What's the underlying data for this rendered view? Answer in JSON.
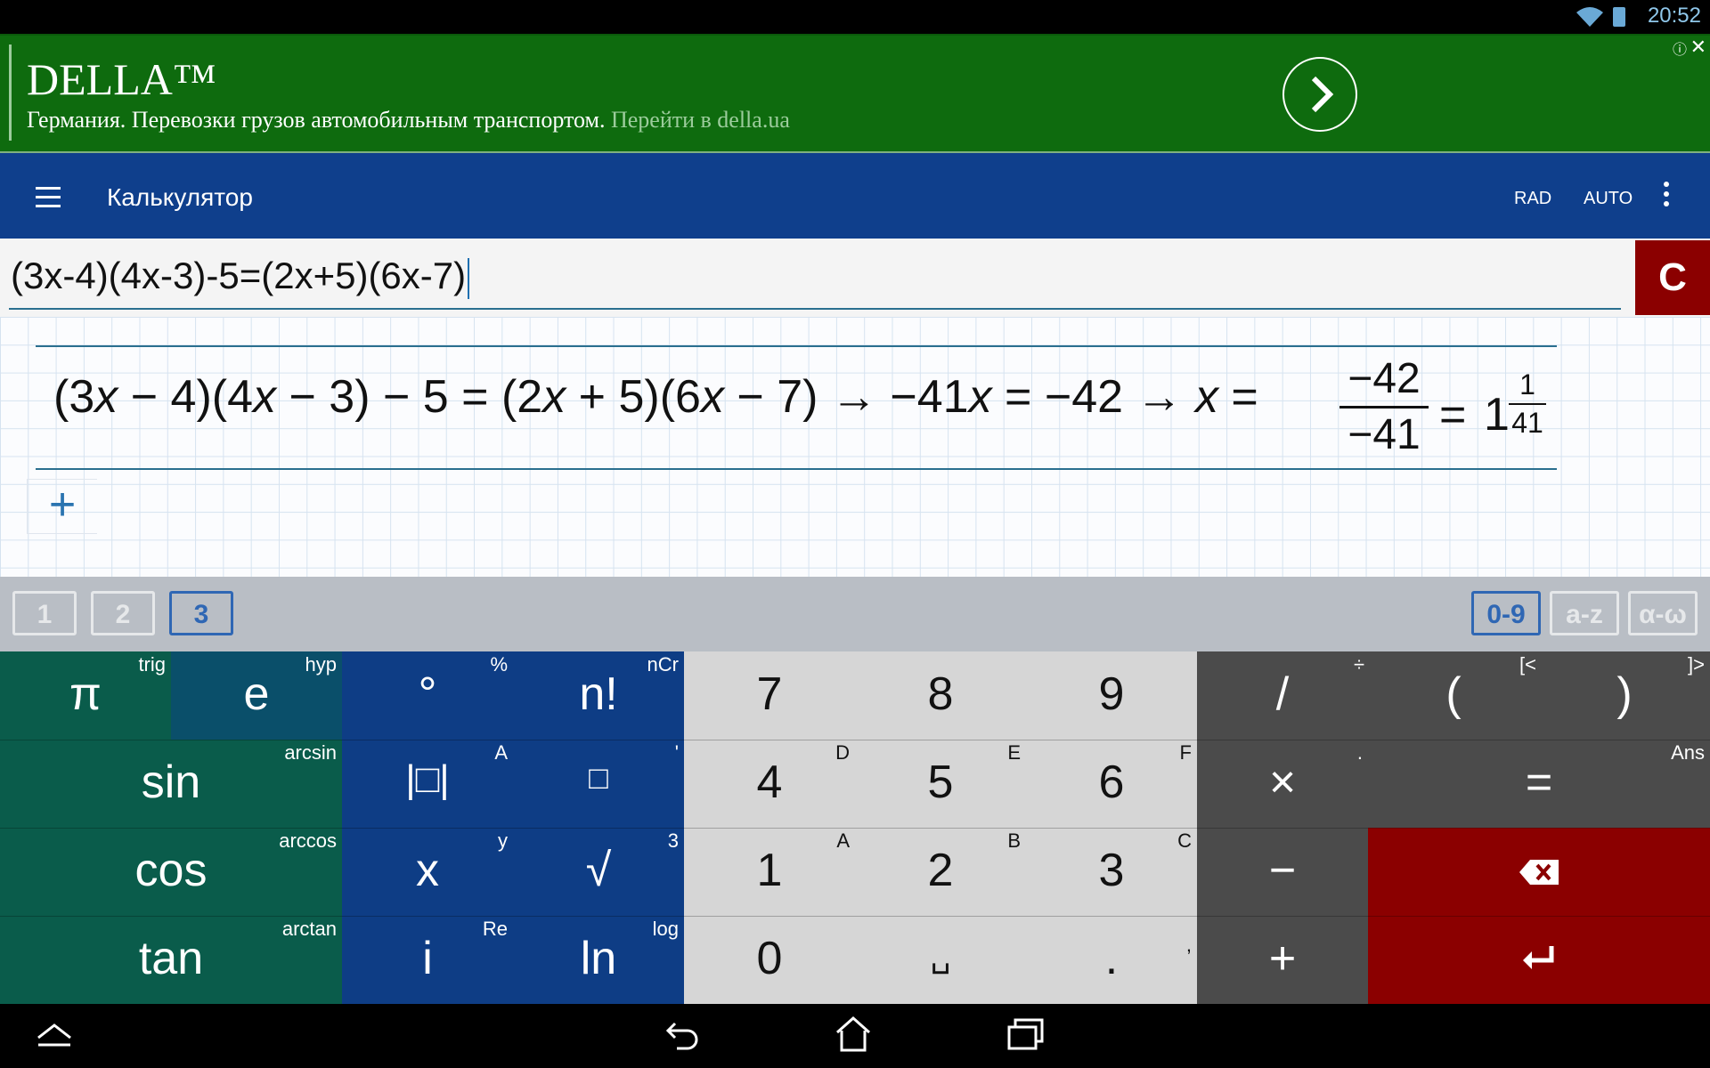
{
  "status": {
    "clock": "20:52"
  },
  "ad": {
    "title": "DELLA™",
    "text": "Германия. Перевозки грузов автомобильным транспортом.",
    "link": "Перейти в della.ua",
    "info_icon": "ⓘ",
    "close_icon": "✕"
  },
  "appbar": {
    "title": "Калькулятор",
    "angle_mode": "RAD",
    "format_mode": "AUTO"
  },
  "input": {
    "expression": "(3x-4)(4x-3)-5=(2x+5)(6x-7)",
    "clear_label": "C"
  },
  "result": {
    "p1": "(",
    "a": "3",
    "x": "x",
    "m1": " − ",
    "b": "4",
    "p2": ")(",
    "c": "4",
    "m2": " − ",
    "d": "3",
    "p3": ") − ",
    "e": "5",
    "eq": " = (",
    "f": "2",
    "plus": " + ",
    "g": "5",
    "p4": ")(",
    "h": "6",
    "m3": " − ",
    "i": "7",
    "p5": ")",
    "arrow1": " → ",
    "lhs": "−41",
    "eq2": " = ",
    "rhs": "−42",
    "arrow2": " → ",
    "eq3": " = ",
    "frac_num": "−42",
    "frac_den": "−41",
    "eq4": "=",
    "whole": "1",
    "mixed_num": "1",
    "mixed_den": "41"
  },
  "add_button": "+",
  "tabs": {
    "pages": [
      "1",
      "2",
      "3"
    ],
    "active_page": "3",
    "modes": [
      "0-9",
      "a-z",
      "α-ω"
    ],
    "active_mode": "0-9"
  },
  "keys": {
    "pi": {
      "main": "π",
      "sup": "trig"
    },
    "e": {
      "main": "e",
      "sup": "hyp"
    },
    "deg": {
      "main": "°",
      "sup": "%"
    },
    "fact": {
      "main": "n!",
      "sup": "nCr"
    },
    "k7": {
      "main": "7",
      "sup": ""
    },
    "k8": {
      "main": "8",
      "sup": ""
    },
    "k9": {
      "main": "9",
      "sup": ""
    },
    "div": {
      "main": "/",
      "sup": "÷"
    },
    "lpar": {
      "main": "(",
      "sup": "[<"
    },
    "rpar": {
      "main": ")",
      "sup": "]>"
    },
    "sin": {
      "main": "sin",
      "sup": "arcsin"
    },
    "abs": {
      "main": "|□|",
      "sup": "A"
    },
    "pow": {
      "main": "□",
      "sup": "'"
    },
    "k4": {
      "main": "4",
      "sup": "D"
    },
    "k5": {
      "main": "5",
      "sup": "E"
    },
    "k6": {
      "main": "6",
      "sup": "F"
    },
    "mul": {
      "main": "×",
      "sup": "."
    },
    "equals": {
      "main": "=",
      "sup": "Ans"
    },
    "cos": {
      "main": "cos",
      "sup": "arccos"
    },
    "x": {
      "main": "x",
      "sup": "y"
    },
    "sqrt": {
      "main": "√",
      "sup": "3"
    },
    "k1": {
      "main": "1",
      "sup": "A"
    },
    "k2": {
      "main": "2",
      "sup": "B"
    },
    "k3": {
      "main": "3",
      "sup": "C"
    },
    "minus": {
      "main": "−",
      "sup": ""
    },
    "tan": {
      "main": "tan",
      "sup": "arctan"
    },
    "i": {
      "main": "i",
      "sup": "Re"
    },
    "ln": {
      "main": "ln",
      "sup": "log"
    },
    "k0": {
      "main": "0",
      "sup": ""
    },
    "space": {
      "main": "␣",
      "sup": ""
    },
    "dot": {
      "main": ".",
      "sup": ","
    },
    "plus": {
      "main": "+",
      "sup": ""
    }
  },
  "colors": {
    "ad_bg": "#0e6b0e",
    "appbar_bg": "#0f3f8c",
    "clear_bg": "#8b0000",
    "key_green": "#0a5c4b",
    "key_blue": "#0e3d85",
    "key_light": "#d6d6d6",
    "key_dark": "#4b4b4b",
    "key_red": "#8b0000"
  },
  "icons": {
    "wifi": "wifi-icon",
    "battery": "battery-icon",
    "backspace": "backspace-icon",
    "enter": "enter-icon",
    "menu": "menu-icon",
    "more": "more-icon",
    "ad_arrow": "chevron-right-icon",
    "nav_hide": "hide-keyboard-icon",
    "nav_back": "back-icon",
    "nav_home": "home-icon",
    "nav_recents": "recents-icon"
  }
}
